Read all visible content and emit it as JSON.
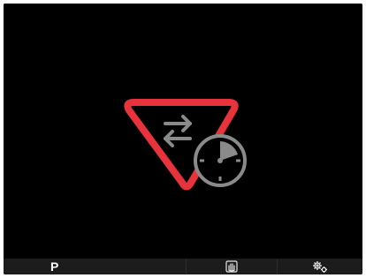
{
  "status_bar": {
    "mode_label": "P",
    "hand_icon": "hand-icon",
    "settings_icon": "gear-icon"
  },
  "warning": {
    "icon": "exchange-clock-warning-icon",
    "triangle_color": "#e8323c",
    "glyph_color": "#8a8a8a"
  }
}
